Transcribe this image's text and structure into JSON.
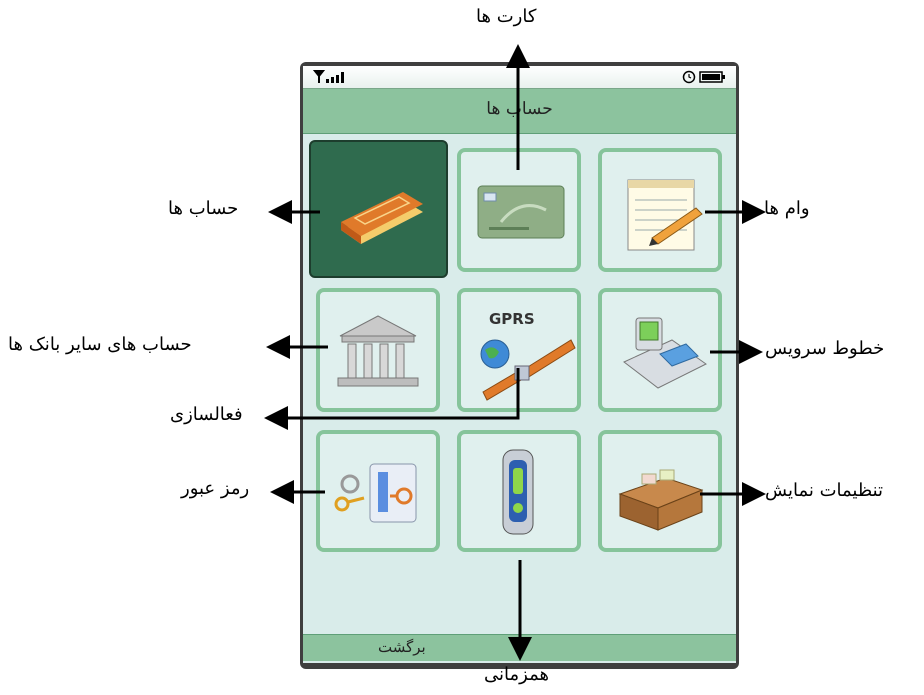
{
  "header": {
    "title": "حساب ها"
  },
  "status": {
    "signal_icon": "signal-icon",
    "alarm_icon": "alarm-icon",
    "battery_icon": "battery-icon"
  },
  "tiles": [
    {
      "icon": "bank-book-icon",
      "selected": true
    },
    {
      "icon": "credit-card-icon",
      "selected": false
    },
    {
      "icon": "notepad-pencil-icon",
      "selected": false
    },
    {
      "icon": "bank-building-icon",
      "selected": false
    },
    {
      "icon": "gprs-satellite-icon",
      "selected": false
    },
    {
      "icon": "phone-terminal-icon",
      "selected": false
    },
    {
      "icon": "lock-key-icon",
      "selected": false
    },
    {
      "icon": "mobile-device-icon",
      "selected": false
    },
    {
      "icon": "desk-drawer-icon",
      "selected": false
    }
  ],
  "gprs_text": "GPRS",
  "footer": {
    "back_label": "برگشت"
  },
  "callouts": {
    "cards": "کارت ها",
    "accounts": "حساب ها",
    "loans": "وام ها",
    "other_bank_accounts": "حساب های سایر بانک ها",
    "service_lines": "خطوط سرویس",
    "activation": "فعالسازی",
    "password": "رمز عبور",
    "display_settings": "تنظیمات نمایش",
    "sync": "همزمانی"
  },
  "colors": {
    "tile_border": "#86c49b",
    "tile_bg": "#e0f0ee",
    "selected_bg": "#2f6b4e",
    "bar_bg": "#8cc39e"
  }
}
